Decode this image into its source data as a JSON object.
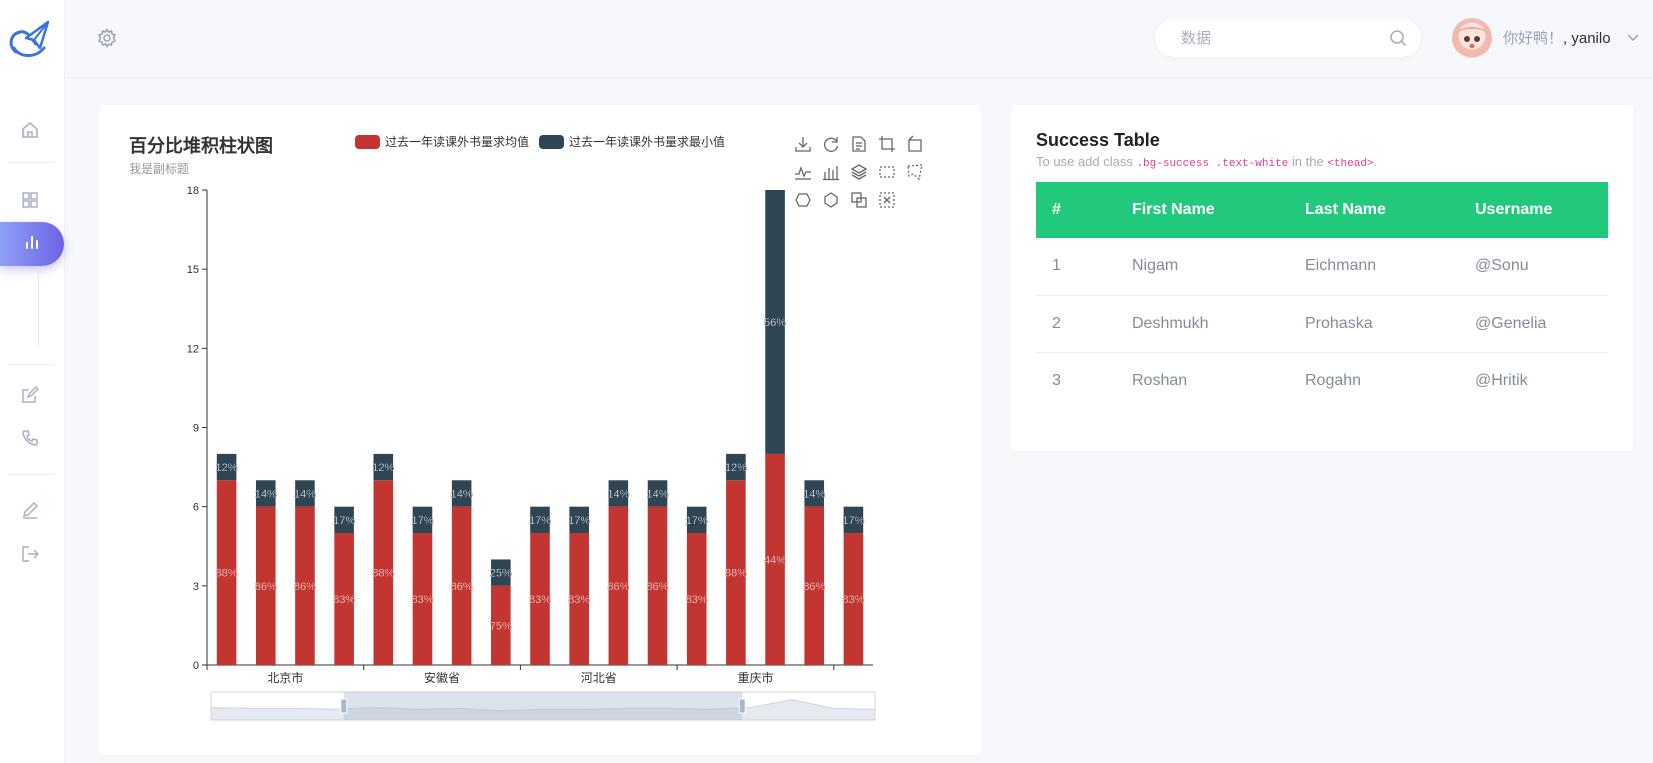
{
  "header": {
    "search_placeholder": "数据",
    "greeting": "你好鸭！",
    "username": ", yanilo"
  },
  "sidebar": {
    "items": [
      "home-icon",
      "grid-icon",
      "chart-icon",
      "edit-icon",
      "phone-icon",
      "pen-icon",
      "logout-icon"
    ],
    "active": "chart-icon"
  },
  "chart_card": {
    "title": "百分比堆积柱状图",
    "subtitle": "我是副标题",
    "legend": [
      {
        "name": "过去一年读课外书量求均值",
        "color": "#c23531"
      },
      {
        "name": "过去一年读课外书量求最小值",
        "color": "#2f4554"
      }
    ]
  },
  "chart_data": {
    "type": "bar",
    "stacked": true,
    "title": "百分比堆积柱状图",
    "subtitle": "我是副标题",
    "x_tick_labels": [
      "北京市",
      "安徽省",
      "河北省",
      "重庆市"
    ],
    "ylim": [
      0,
      18
    ],
    "yticks": [
      0,
      3,
      6,
      9,
      12,
      15,
      18
    ],
    "series": [
      {
        "name": "过去一年读课外书量求均值",
        "color": "#c23531",
        "values": [
          7,
          6,
          6,
          5,
          7,
          5,
          6,
          3,
          5,
          5,
          6,
          6,
          5,
          7,
          8,
          6,
          5
        ],
        "labels": [
          "88%",
          "86%",
          "86%",
          "83%",
          "88%",
          "83%",
          "86%",
          "75%",
          "83%",
          "83%",
          "86%",
          "86%",
          "83%",
          "88%",
          "44%",
          "86%",
          "83%"
        ]
      },
      {
        "name": "过去一年读课外书量求最小值",
        "color": "#2f4554",
        "values": [
          1,
          1,
          1,
          1,
          1,
          1,
          1,
          1,
          1,
          1,
          1,
          1,
          1,
          1,
          10,
          1,
          1
        ],
        "labels": [
          "12%",
          "14%",
          "14%",
          "17%",
          "12%",
          "17%",
          "14%",
          "25%",
          "17%",
          "17%",
          "14%",
          "14%",
          "17%",
          "12%",
          "56%",
          "14%",
          "17%"
        ]
      }
    ],
    "legend_position": "top",
    "data_zoom": {
      "start": 0.2,
      "end": 0.8
    }
  },
  "table_card": {
    "title": "Success Table",
    "desc_prefix": "To use add class ",
    "desc_code1": ".bg-success .text-white",
    "desc_mid": " in the ",
    "desc_code2": "<thead>",
    "desc_suffix": ".",
    "columns": [
      "#",
      "First Name",
      "Last Name",
      "Username"
    ],
    "rows": [
      [
        "1",
        "Nigam",
        "Eichmann",
        "@Sonu"
      ],
      [
        "2",
        "Deshmukh",
        "Prohaska",
        "@Genelia"
      ],
      [
        "3",
        "Roshan",
        "Rogahn",
        "@Hritik"
      ]
    ],
    "header_color": "#22c97d"
  }
}
